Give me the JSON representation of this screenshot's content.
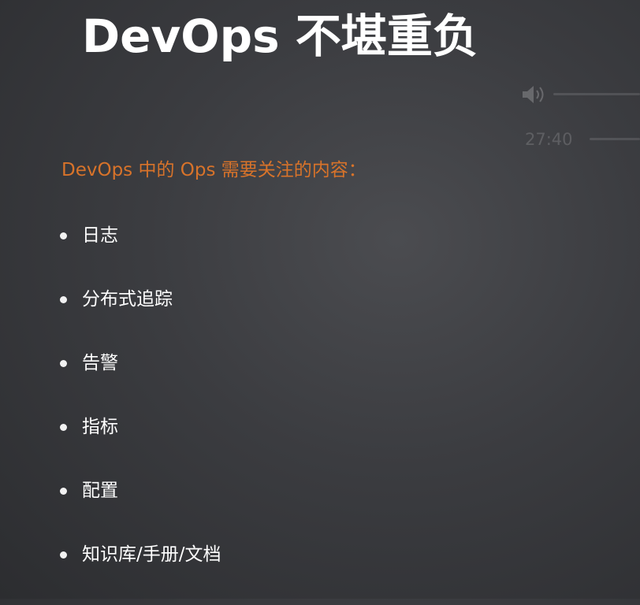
{
  "slide": {
    "title": "DevOps 不堪重负",
    "subtitle": "DevOps 中的 Ops 需要关注的内容：",
    "bullets": [
      "日志",
      "分布式追踪",
      "告警",
      "指标",
      "配置",
      "知识库/手册/文档"
    ]
  },
  "player": {
    "time": "27:40",
    "volume_icon": "speaker-icon"
  },
  "colors": {
    "accent": "#d8732a",
    "background": "#3b3c40",
    "text": "#ffffff"
  }
}
